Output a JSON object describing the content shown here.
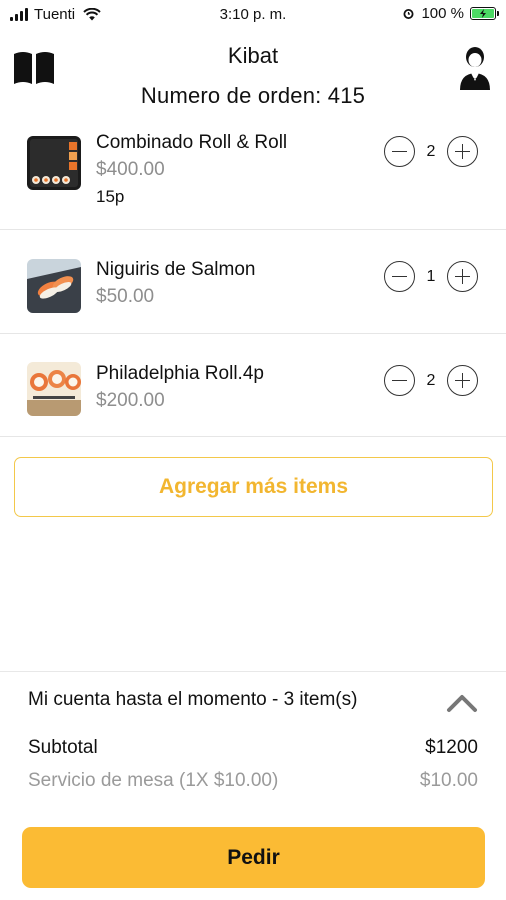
{
  "status_bar": {
    "carrier": "Tuenti",
    "time": "3:10 p. m.",
    "battery": "100 %",
    "icons": [
      "signal-icon",
      "wifi-icon",
      "alarm-icon",
      "battery-charging-icon"
    ]
  },
  "header": {
    "title": "Kibat",
    "order_number": "Numero de orden: 415",
    "left_icon": "menu-book-icon",
    "right_icon": "waiter-icon"
  },
  "items": [
    {
      "name": "Combinado Roll & Roll",
      "price": "$400.00",
      "extra": "15p",
      "quantity": "2"
    },
    {
      "name": "Niguiris de Salmon",
      "price": "$50.00",
      "extra": "",
      "quantity": "1"
    },
    {
      "name": "Philadelphia Roll.4p",
      "price": "$200.00",
      "extra": "",
      "quantity": "2"
    }
  ],
  "add_more_label": "Agregar más items",
  "summary": {
    "title": "Mi cuenta hasta el momento - 3 item(s)",
    "subtotal_label": "Subtotal",
    "subtotal_value": "$1200",
    "service_label": "Servicio de mesa (1X $10.00)",
    "service_value": "$10.00"
  },
  "order_button_label": "Pedir",
  "colors": {
    "accent": "#fbbb34",
    "accent_text": "#f2b630",
    "muted_text": "#8e8e8e",
    "battery_green": "#4cd964"
  }
}
